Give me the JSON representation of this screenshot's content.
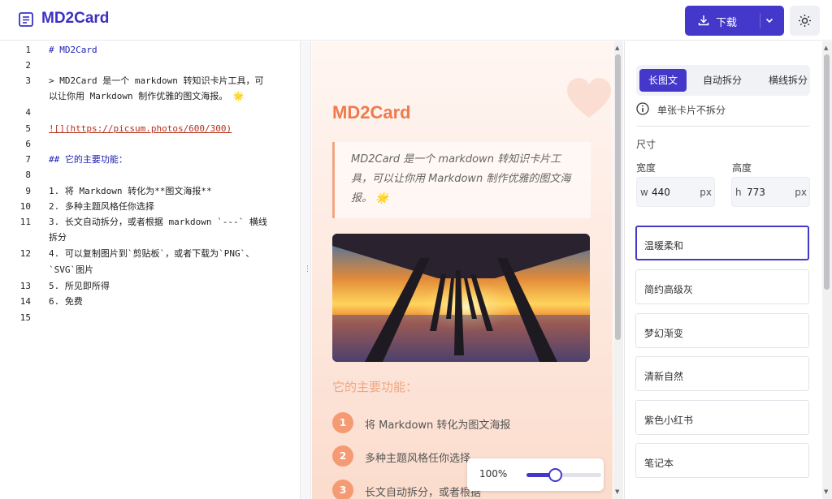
{
  "header": {
    "app_title": "MD2Card",
    "download_label": "下载",
    "icons": {
      "logo": "markdown-doc-icon",
      "download": "download-icon",
      "dropdown": "chevron-down-icon",
      "theme": "sun-icon"
    },
    "accent_color": "#4338ca"
  },
  "editor": {
    "lines": [
      {
        "n": "1",
        "text": "# MD2Card"
      },
      {
        "n": "2",
        "text": ""
      },
      {
        "n": "3",
        "text": "> MD2Card 是一个 markdown 转知识卡片工具，可"
      },
      {
        "n": "",
        "text": "以让你用 Markdown 制作优雅的图文海报。 🌟"
      },
      {
        "n": "4",
        "text": ""
      },
      {
        "n": "5",
        "text": "![](https://picsum.photos/600/300)"
      },
      {
        "n": "6",
        "text": ""
      },
      {
        "n": "7",
        "text": "## 它的主要功能："
      },
      {
        "n": "8",
        "text": ""
      },
      {
        "n": "9",
        "text": "1. 将 Markdown 转化为**图文海报**"
      },
      {
        "n": "10",
        "text": "2. 多种主题风格任你选择"
      },
      {
        "n": "11",
        "text": "3. 长文自动拆分，或者根据 markdown `---` 横线"
      },
      {
        "n": "",
        "text": "拆分"
      },
      {
        "n": "12",
        "text": "4. 可以复制图片到`剪贴板`，或者下载为`PNG`、"
      },
      {
        "n": "",
        "text": "`SVG`图片"
      },
      {
        "n": "13",
        "text": "5. 所见即所得"
      },
      {
        "n": "14",
        "text": "6. 免费"
      },
      {
        "n": "15",
        "text": ""
      }
    ]
  },
  "preview": {
    "card_title": "MD2Card",
    "quote": "MD2Card 是一个 markdown 转知识卡片工具，可以让你用 Markdown 制作优雅的图文海报。 🌟",
    "section_title": "它的主要功能：",
    "features": [
      {
        "num": "1",
        "text": "将 Markdown 转化为图文海报"
      },
      {
        "num": "2",
        "text": "多种主题风格任你选择"
      },
      {
        "num": "3",
        "text": "长文自动拆分，或者根据"
      }
    ],
    "zoom_label": "100%",
    "zoom_fraction": 0.38,
    "image_icon": "pier-sunset-photo"
  },
  "settings": {
    "tabs": [
      "长图文",
      "自动拆分",
      "横线拆分"
    ],
    "active_tab": 0,
    "info_text": "单张卡片不拆分",
    "size_label": "尺寸",
    "width_label": "宽度",
    "height_label": "高度",
    "width": {
      "prefix": "w",
      "value": "440",
      "unit": "px"
    },
    "height": {
      "prefix": "h",
      "value": "773",
      "unit": "px"
    },
    "themes": [
      "温暖柔和",
      "简约高级灰",
      "梦幻渐变",
      "清新自然",
      "紫色小红书",
      "笔记本"
    ],
    "selected_theme": 0
  }
}
